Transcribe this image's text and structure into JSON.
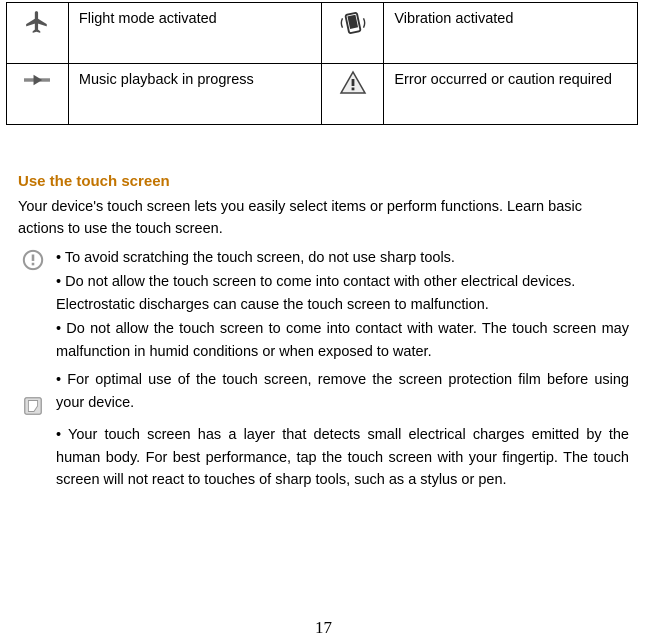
{
  "icons_table": {
    "rows": [
      [
        {
          "icon": "airplane-icon",
          "label": "Flight mode activated"
        },
        {
          "icon": "vibration-icon",
          "label": "Vibration activated"
        }
      ],
      [
        {
          "icon": "music-playback-icon",
          "label": "Music playback in progress"
        },
        {
          "icon": "caution-icon",
          "label": "Error occurred or caution required"
        }
      ]
    ]
  },
  "section": {
    "heading": "Use the touch screen",
    "intro": "Your device's touch screen lets you easily select items or perform functions. Learn basic actions to use the touch screen.",
    "bullets": [
      "• To avoid scratching the touch screen, do not use sharp tools.",
      "• Do not allow the touch screen to come into contact with other electrical devices. Electrostatic discharges can cause the touch screen to malfunction.",
      "• Do not allow the touch screen to come into contact with water. The touch screen may malfunction in humid conditions or when exposed to water.",
      "• For optimal use of the touch screen, remove the screen protection film before using your device.",
      "• Your touch screen has a layer that detects small electrical charges emitted by the human body. For best performance, tap the touch screen with your fingertip. The touch screen will not react to touches of sharp tools, such as a stylus or pen."
    ]
  },
  "page_number": "17"
}
